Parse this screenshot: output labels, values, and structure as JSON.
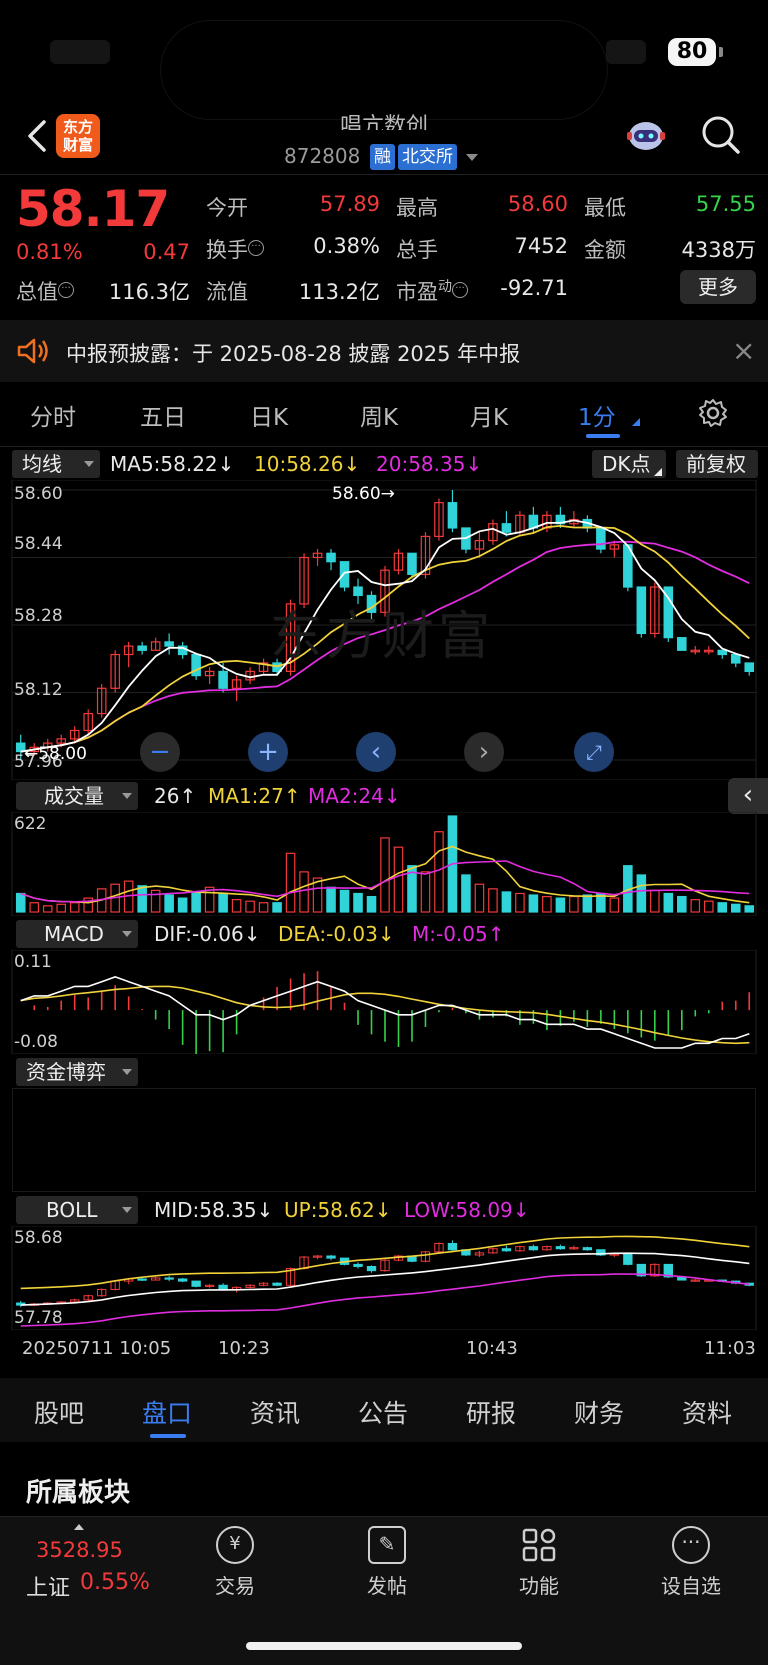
{
  "status_bar": {
    "battery": "80"
  },
  "header": {
    "title": "唱亢数创",
    "code": "872808",
    "tag_margin": "融",
    "tag_exchange": "北交所",
    "logo_line1": "东方",
    "logo_line2": "财富"
  },
  "quote": {
    "price": "58.17",
    "change_pct": "0.81%",
    "change_amt": "0.47",
    "open_label": "今开",
    "open": "57.89",
    "high_label": "最高",
    "high": "58.60",
    "low_label": "最低",
    "low": "57.55",
    "turnover_label": "换手",
    "turnover": "0.38%",
    "volume_label": "总手",
    "volume": "7452",
    "amount_label": "金额",
    "amount": "4338万",
    "mktcap_label": "总值",
    "mktcap": "116.3亿",
    "float_label": "流值",
    "float": "113.2亿",
    "pe_label": "市盈",
    "pe_sup": "动",
    "pe": "-92.71",
    "more": "更多"
  },
  "notice": {
    "text": "中报预披露：于 2025-08-28 披露 2025 年中报"
  },
  "period_tabs": [
    "分时",
    "五日",
    "日K",
    "周K",
    "月K",
    "1分"
  ],
  "period_active": "1分",
  "ma": {
    "selector": "均线",
    "ma5": "MA5:58.22↓",
    "ma10": "10:58.26↓",
    "ma20": "20:58.35↓",
    "dk": "DK点",
    "adjust": "前复权"
  },
  "price_axis": [
    "58.60",
    "58.44",
    "58.28",
    "58.12",
    "57.96"
  ],
  "price_marks": {
    "high": "58.60→",
    "low": "←58.00"
  },
  "volume": {
    "selector": "成交量",
    "vol": "26↑",
    "ma1": "MA1:27↑",
    "ma2": "MA2:24↓",
    "axis_top": "622"
  },
  "macd": {
    "selector": "MACD",
    "dif": "DIF:-0.06↓",
    "dea": "DEA:-0.03↓",
    "m": "M:-0.05↑",
    "axis_top": "0.11",
    "axis_bottom": "-0.08"
  },
  "fund": {
    "selector": "资金博弈"
  },
  "boll": {
    "selector": "BOLL",
    "mid": "MID:58.35↓",
    "up": "UP:58.62↓",
    "low": "LOW:58.09↓",
    "axis_top": "58.68",
    "axis_bottom": "57.78"
  },
  "time_axis": [
    "20250711 10:05",
    "10:23",
    "10:43",
    "11:03"
  ],
  "bottom_tabs": [
    "股吧",
    "盘口",
    "资讯",
    "公告",
    "研报",
    "财务",
    "资料"
  ],
  "bottom_tab_active": "盘口",
  "section": {
    "title": "所属板块"
  },
  "index": {
    "value": "3528.95",
    "name": "上证",
    "pct": "0.55%"
  },
  "nav": [
    "交易",
    "发帖",
    "功能",
    "设自选"
  ],
  "colors": {
    "up": "#f23a3a",
    "down": "#2fd3d8",
    "ma5": "#ffffff",
    "ma10": "#f0d23a",
    "ma20": "#e02de0",
    "accent": "#3a7df0"
  },
  "chart_data": {
    "type": "candlestick",
    "title": "",
    "ylim": [
      57.96,
      58.6
    ],
    "ohlc": [
      [
        58.0,
        58.02,
        57.96,
        57.98
      ],
      [
        57.98,
        58.0,
        57.97,
        57.99
      ],
      [
        57.99,
        58.01,
        57.98,
        58.0
      ],
      [
        58.0,
        58.02,
        57.99,
        58.01
      ],
      [
        58.01,
        58.04,
        58.0,
        58.03
      ],
      [
        58.03,
        58.08,
        58.02,
        58.07
      ],
      [
        58.07,
        58.14,
        58.06,
        58.13
      ],
      [
        58.13,
        58.22,
        58.12,
        58.21
      ],
      [
        58.21,
        58.24,
        58.18,
        58.23
      ],
      [
        58.23,
        58.24,
        58.21,
        58.22
      ],
      [
        58.22,
        58.25,
        58.22,
        58.24
      ],
      [
        58.24,
        58.26,
        58.21,
        58.23
      ],
      [
        58.23,
        58.24,
        58.2,
        58.21
      ],
      [
        58.21,
        58.2,
        58.15,
        58.16
      ],
      [
        58.16,
        58.18,
        58.14,
        58.17
      ],
      [
        58.17,
        58.19,
        58.12,
        58.13
      ],
      [
        58.13,
        58.16,
        58.1,
        58.15
      ],
      [
        58.15,
        58.18,
        58.14,
        58.17
      ],
      [
        58.17,
        58.2,
        58.16,
        58.19
      ],
      [
        58.19,
        58.2,
        58.16,
        58.17
      ],
      [
        58.17,
        58.34,
        58.16,
        58.33
      ],
      [
        58.33,
        58.45,
        58.32,
        58.44
      ],
      [
        58.44,
        58.46,
        58.42,
        58.45
      ],
      [
        58.45,
        58.46,
        58.41,
        58.43
      ],
      [
        58.43,
        58.42,
        58.36,
        58.37
      ],
      [
        58.37,
        58.39,
        58.33,
        58.35
      ],
      [
        58.35,
        58.36,
        58.29,
        58.31
      ],
      [
        58.31,
        58.42,
        58.3,
        58.41
      ],
      [
        58.41,
        58.46,
        58.4,
        58.45
      ],
      [
        58.45,
        58.44,
        58.39,
        58.4
      ],
      [
        58.4,
        58.5,
        58.39,
        58.49
      ],
      [
        58.49,
        58.58,
        58.48,
        58.57
      ],
      [
        58.57,
        58.6,
        58.5,
        58.51
      ],
      [
        58.51,
        58.5,
        58.45,
        58.46
      ],
      [
        58.46,
        58.5,
        58.44,
        58.48
      ],
      [
        58.48,
        58.53,
        58.47,
        58.52
      ],
      [
        58.52,
        58.55,
        58.49,
        58.5
      ],
      [
        58.5,
        58.55,
        58.49,
        58.54
      ],
      [
        58.54,
        58.56,
        58.5,
        58.51
      ],
      [
        58.51,
        58.55,
        58.5,
        58.54
      ],
      [
        58.54,
        58.56,
        58.51,
        58.52
      ],
      [
        58.52,
        58.55,
        58.51,
        58.53
      ],
      [
        58.53,
        58.54,
        58.5,
        58.51
      ],
      [
        58.51,
        58.5,
        58.45,
        58.46
      ],
      [
        58.46,
        58.48,
        58.44,
        58.47
      ],
      [
        58.47,
        58.46,
        58.36,
        58.37
      ],
      [
        58.37,
        58.36,
        58.25,
        58.26
      ],
      [
        58.26,
        58.38,
        58.25,
        58.37
      ],
      [
        58.37,
        58.36,
        58.24,
        58.25
      ],
      [
        58.25,
        58.24,
        58.22,
        58.22
      ],
      [
        58.22,
        58.23,
        58.21,
        58.22
      ],
      [
        58.22,
        58.23,
        58.21,
        58.22
      ],
      [
        58.22,
        58.22,
        58.2,
        58.21
      ],
      [
        58.21,
        58.21,
        58.18,
        58.19
      ],
      [
        58.19,
        58.18,
        58.16,
        58.17
      ]
    ],
    "volume": [
      120,
      60,
      40,
      50,
      60,
      90,
      150,
      180,
      200,
      170,
      140,
      110,
      90,
      130,
      160,
      120,
      80,
      70,
      60,
      60,
      380,
      260,
      220,
      160,
      140,
      120,
      100,
      480,
      420,
      300,
      260,
      520,
      622,
      240,
      180,
      150,
      130,
      120,
      110,
      100,
      90,
      100,
      110,
      120,
      90,
      300,
      240,
      140,
      120,
      100,
      80,
      70,
      60,
      50,
      40
    ],
    "macd": [
      0.02,
      0.03,
      0.03,
      0.04,
      0.05,
      0.05,
      0.06,
      0.07,
      0.06,
      0.05,
      0.04,
      0.03,
      0.01,
      -0.01,
      -0.01,
      -0.02,
      -0.01,
      0.01,
      0.02,
      0.03,
      0.04,
      0.05,
      0.06,
      0.05,
      0.04,
      0.02,
      0.01,
      0.0,
      -0.01,
      -0.01,
      0.0,
      0.01,
      0.01,
      0.0,
      -0.01,
      -0.01,
      -0.01,
      -0.02,
      -0.02,
      -0.03,
      -0.03,
      -0.03,
      -0.04,
      -0.04,
      -0.05,
      -0.06,
      -0.07,
      -0.08,
      -0.08,
      -0.08,
      -0.07,
      -0.07,
      -0.06,
      -0.06,
      -0.05
    ]
  }
}
